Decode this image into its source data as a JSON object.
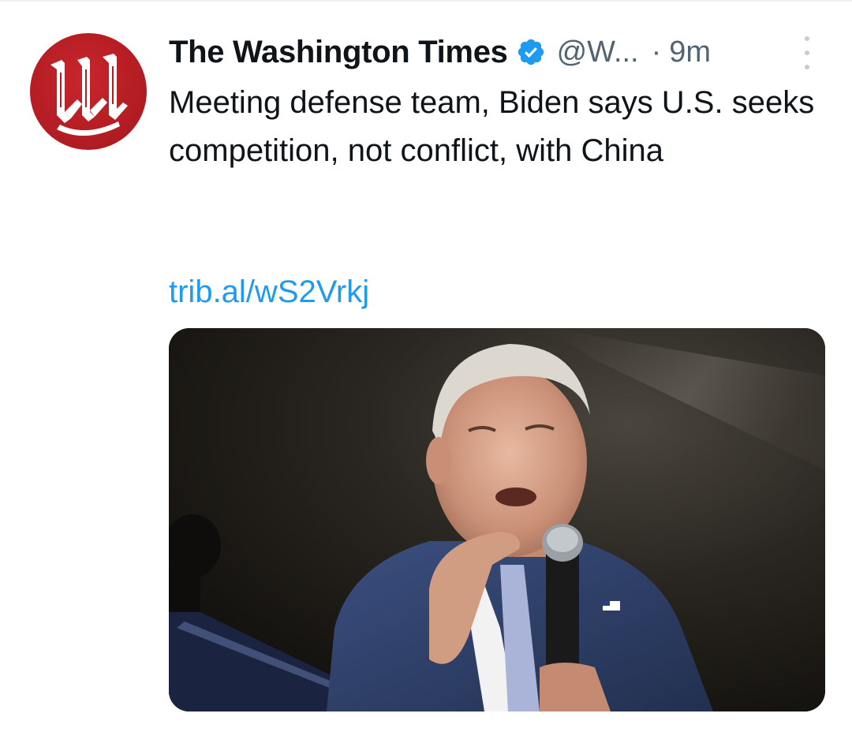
{
  "tweet": {
    "display_name": "The Washington Times",
    "handle": "@W...",
    "separator": "·",
    "time": "9m",
    "text": "Meeting defense team, Biden says U.S. seeks competition, not conflict, with China",
    "link": "trib.al/wS2Vrkj",
    "media_alt": "Joe Biden speaking into a microphone"
  },
  "icons": {
    "verified": "verified-badge-icon",
    "more": "more-options-icon",
    "avatar_logo": "washington-times-w-logo"
  },
  "colors": {
    "text_primary": "#0f1419",
    "text_secondary": "#536471",
    "link": "#1d9bf0",
    "verified": "#1d9bf0",
    "avatar_red": "#b01c22"
  }
}
